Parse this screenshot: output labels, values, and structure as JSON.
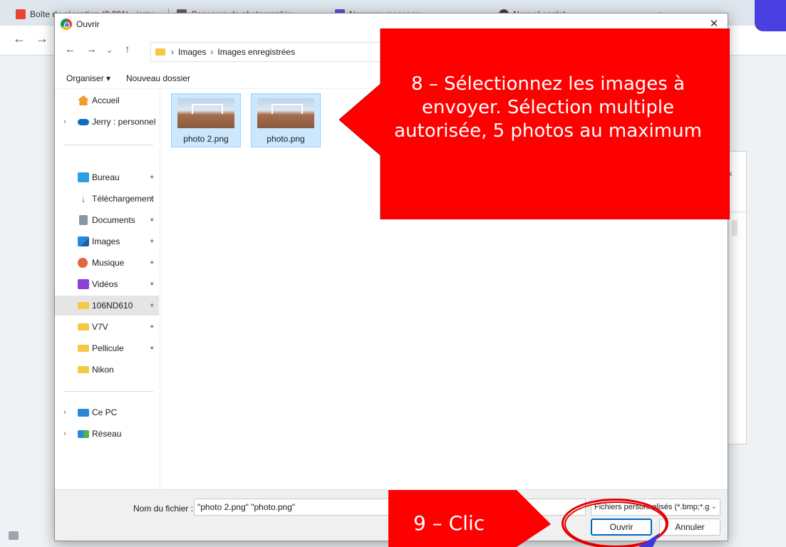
{
  "browser": {
    "tabs": [
      {
        "label": "Boîte de réception (2 091) - jerry"
      },
      {
        "label": "Concours de photographie"
      },
      {
        "label": "Nouveau message"
      },
      {
        "label": "Nouvel onglet"
      }
    ],
    "new_tab": "+"
  },
  "dialog": {
    "title": "Ouvrir",
    "close": "✕",
    "breadcrumb": [
      "Images",
      "Images enregistrées"
    ],
    "commands": {
      "organize": "Organiser ▾",
      "new_folder": "Nouveau dossier"
    },
    "sidebar": {
      "items_top": [
        {
          "label": "Accueil",
          "icon": "home-icon"
        },
        {
          "label": "Jerry : personnel",
          "icon": "onedrive-icon"
        }
      ],
      "quick_access": [
        {
          "label": "Bureau",
          "icon": "desktop-icon"
        },
        {
          "label": "Téléchargement",
          "icon": "download-icon"
        },
        {
          "label": "Documents",
          "icon": "documents-icon"
        },
        {
          "label": "Images",
          "icon": "pictures-icon"
        },
        {
          "label": "Musique",
          "icon": "music-icon"
        },
        {
          "label": "Vidéos",
          "icon": "videos-icon"
        },
        {
          "label": "106ND610",
          "icon": "folder-icon"
        },
        {
          "label": "V7V",
          "icon": "folder-icon"
        },
        {
          "label": "Pellicule",
          "icon": "folder-icon"
        },
        {
          "label": "Nikon",
          "icon": "folder-icon"
        }
      ],
      "items_bottom": [
        {
          "label": "Ce PC",
          "icon": "computer-icon"
        },
        {
          "label": "Réseau",
          "icon": "network-icon"
        }
      ]
    },
    "files": [
      {
        "name": "photo 2.png"
      },
      {
        "name": "photo.png"
      }
    ],
    "filename_label": "Nom du fichier :",
    "filename_value": "\"photo 2.png\" \"photo.png\"",
    "filter_value": "Fichiers personnalisés (*.bmp;*.g",
    "open_button": "Ouvrir",
    "cancel_button": "Annuler"
  },
  "annotations": {
    "step8": "8 – Sélectionnez les images à envoyer. Sélection multiple autorisée, 5 photos au maximum",
    "step9": "9 – Clic"
  },
  "colors": {
    "annotation": "#ff0000",
    "selection": "#cce8ff",
    "accent": "#0067c0"
  }
}
